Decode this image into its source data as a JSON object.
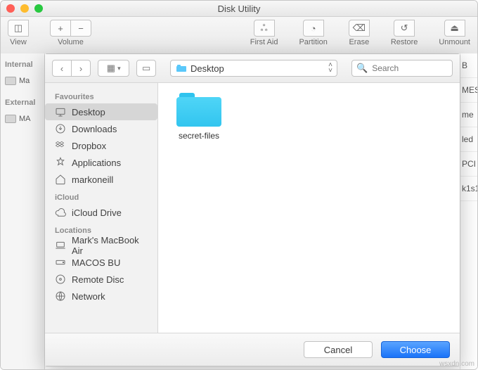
{
  "window": {
    "title": "Disk Utility"
  },
  "toolbar": {
    "view": "View",
    "volume": "Volume",
    "firstaid": "First Aid",
    "partition": "Partition",
    "erase": "Erase",
    "restore": "Restore",
    "unmount": "Unmount"
  },
  "leftside": {
    "internal_hdr": "Internal",
    "internal_item": "Ma",
    "external_hdr": "External",
    "external_item": "MA"
  },
  "dialog": {
    "location_label": "Desktop",
    "search_placeholder": "Search",
    "sidebar": {
      "favourites_hdr": "Favourites",
      "desktop": "Desktop",
      "downloads": "Downloads",
      "dropbox": "Dropbox",
      "applications": "Applications",
      "home": "markoneill",
      "icloud_hdr": "iCloud",
      "iclouddrive": "iCloud Drive",
      "locations_hdr": "Locations",
      "machine": "Mark's MacBook Air",
      "backup": "MACOS BU",
      "remote": "Remote Disc",
      "network": "Network"
    },
    "files": [
      {
        "name": "secret-files"
      }
    ],
    "cancel": "Cancel",
    "choose": "Choose"
  },
  "peek": {
    "a": "B",
    "b": "MES",
    "c": "me",
    "d": "led",
    "e": "PCI",
    "f": "k1s1"
  },
  "watermark": "wsxdn.com"
}
